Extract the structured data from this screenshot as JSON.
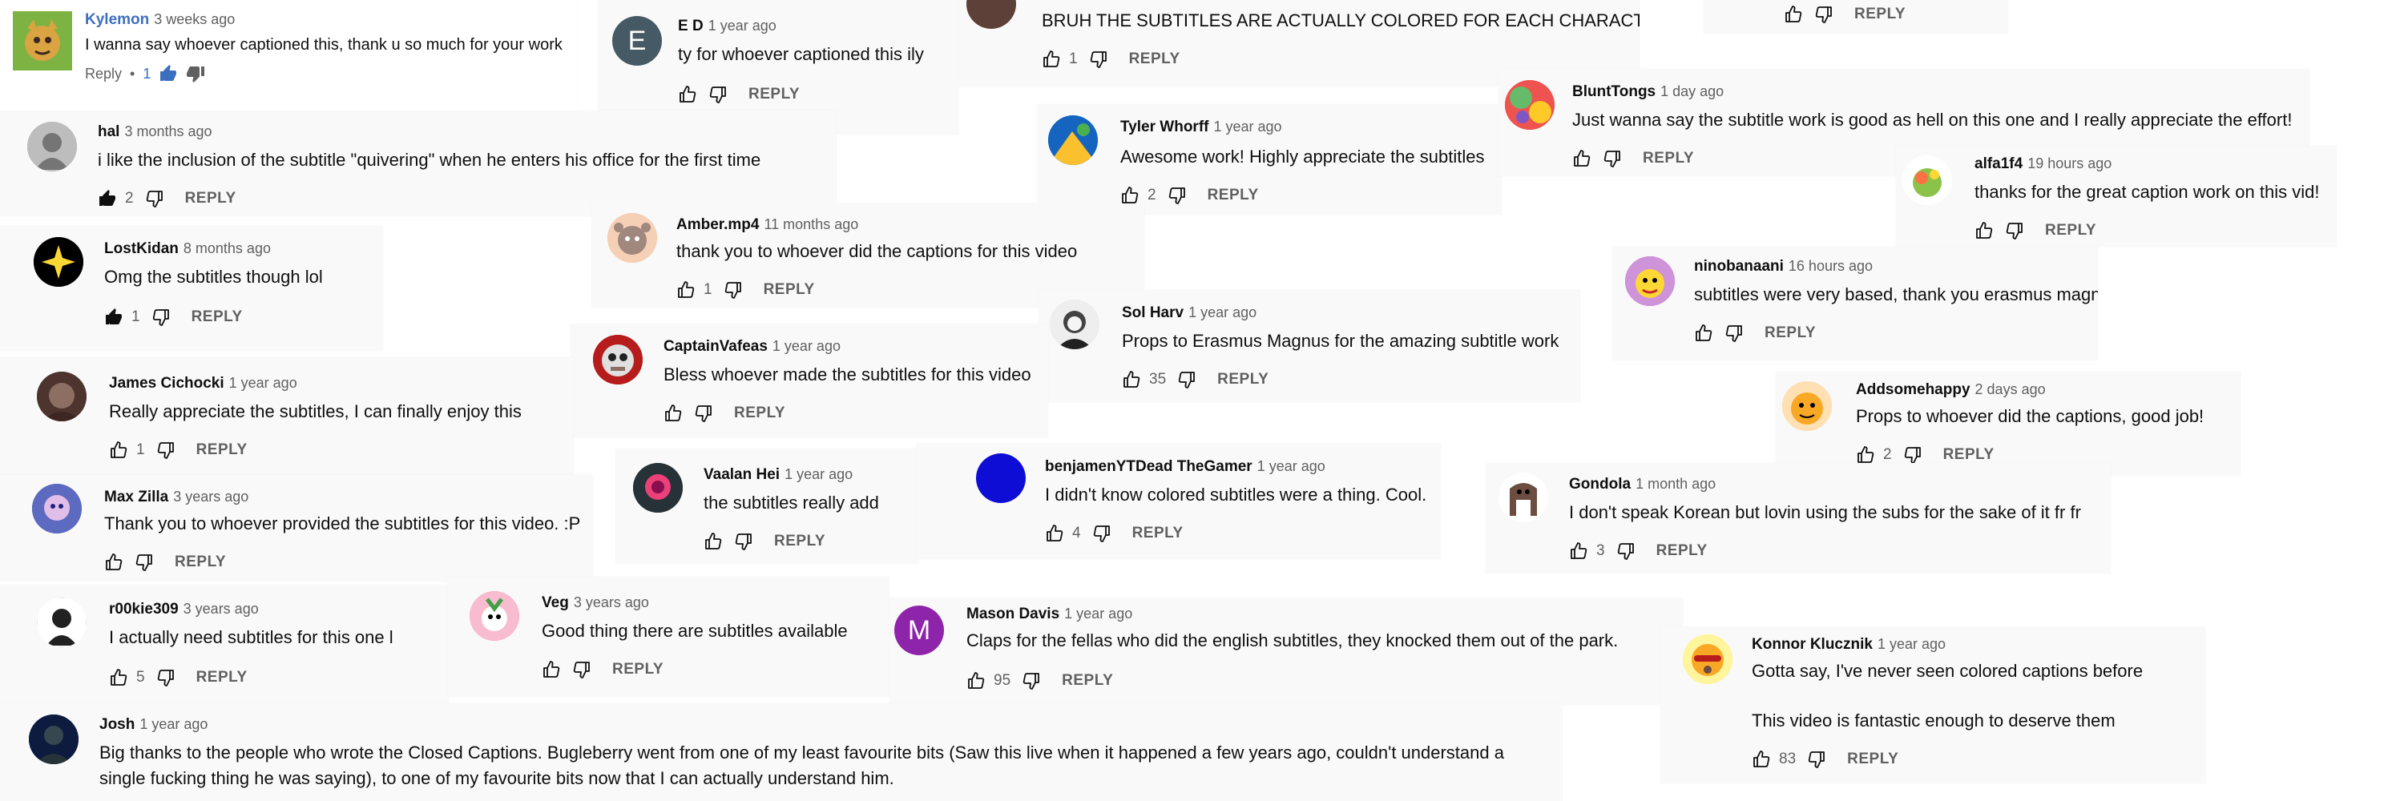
{
  "reply_label": "REPLY",
  "colors": {
    "filled_like": "#0f0f0f",
    "outline": "#606060",
    "blue_like": "#3d6fbf"
  },
  "comments": {
    "c01": {
      "author": "Kylemon",
      "time": "3 weeks ago",
      "text": "I wanna say whoever captioned this, thank u so much for your work",
      "reply": "Reply",
      "likes": "1"
    },
    "c02": {
      "author": "E D",
      "avatar_letter": "E",
      "time": "1 year ago",
      "text": "ty for whoever captioned this ily"
    },
    "c03": {
      "text": "BRUH THE SUBTITLES ARE ACTUALLY COLORED FOR EACH CHARACTER!!!!",
      "likes": "1"
    },
    "c05": {
      "author": "hal",
      "time": "3 months ago",
      "text": "i like the inclusion of the subtitle \"quivering\" when he enters his office for the first time",
      "likes": "2"
    },
    "c06": {
      "author": "Tyler Whorff",
      "time": "1 year ago",
      "text": "Awesome work! Highly appreciate the subtitles",
      "likes": "2"
    },
    "c07": {
      "author": "BluntTongs",
      "time": "1 day ago",
      "text": "Just wanna say the subtitle work is good as hell on this one and I really appreciate the effort!"
    },
    "c08": {
      "author": "alfa1f4",
      "time": "19 hours ago",
      "text": "thanks for the great caption work on this vid!"
    },
    "c09": {
      "author": "Amber.mp4",
      "time": "11 months ago",
      "text": "thank you to whoever did the captions for this video",
      "likes": "1"
    },
    "c10": {
      "author": "LostKidan",
      "time": "8 months ago",
      "text": "Omg the subtitles though lol",
      "likes": "1"
    },
    "c11": {
      "author": "ninobanaani",
      "time": "16 hours ago",
      "text": "subtitles were very based, thank you erasmus magnus"
    },
    "c12": {
      "author": "Sol Harv",
      "time": "1 year ago",
      "text": "Props to Erasmus Magnus for the amazing subtitle work",
      "likes": "35"
    },
    "c13": {
      "author": "CaptainVafeas",
      "time": "1 year ago",
      "text": "Bless whoever made the subtitles for this video"
    },
    "c14": {
      "author": "James Cichocki",
      "time": "1 year ago",
      "text": "Really appreciate the subtitles, I can finally enjoy this",
      "likes": "1"
    },
    "c15": {
      "author": "Addsomehappy",
      "time": "2 days ago",
      "text": "Props to whoever did the captions, good job!",
      "likes": "2"
    },
    "c16": {
      "author": "Vaalan Hei",
      "time": "1 year ago",
      "text": "the subtitles really add"
    },
    "c17": {
      "author": "benjamenYTDead TheGamer",
      "time": "1 year ago",
      "text": "I didn't know colored subtitles were a thing. Cool.",
      "likes": "4"
    },
    "c18": {
      "author": "Gondola",
      "time": "1 month ago",
      "text": "I don't speak Korean but lovin using the subs for the sake of it fr fr",
      "likes": "3"
    },
    "c19": {
      "author": "Max Zilla",
      "time": "3 years ago",
      "text": "Thank you to whoever provided the subtitles for this video. :P"
    },
    "c20": {
      "author": "r00kie309",
      "time": "3 years ago",
      "text": "I actually need subtitles for this one l",
      "likes": "5"
    },
    "c21": {
      "author": "Veg",
      "time": "3 years ago",
      "text": "Good thing there are subtitles available"
    },
    "c22": {
      "author": "Mason Davis",
      "avatar_letter": "M",
      "time": "1 year ago",
      "text": "Claps for the fellas who did the english subtitles, they knocked them out of the park.",
      "likes": "95"
    },
    "c23": {
      "author": "Konnor Klucznik",
      "time": "1 year ago",
      "text": "Gotta say, I've never seen colored captions before",
      "text2": "This video is fantastic enough to deserve them",
      "likes": "83"
    },
    "c24": {
      "author": "Josh",
      "time": "1 year ago",
      "text": "Big thanks to the people who wrote the Closed Captions. Bugleberry went from one of my least favourite bits (Saw this live when it happened a few years ago, couldn't understand a single fucking thing he was saying), to one of my favourite bits now that I can actually understand him."
    }
  }
}
